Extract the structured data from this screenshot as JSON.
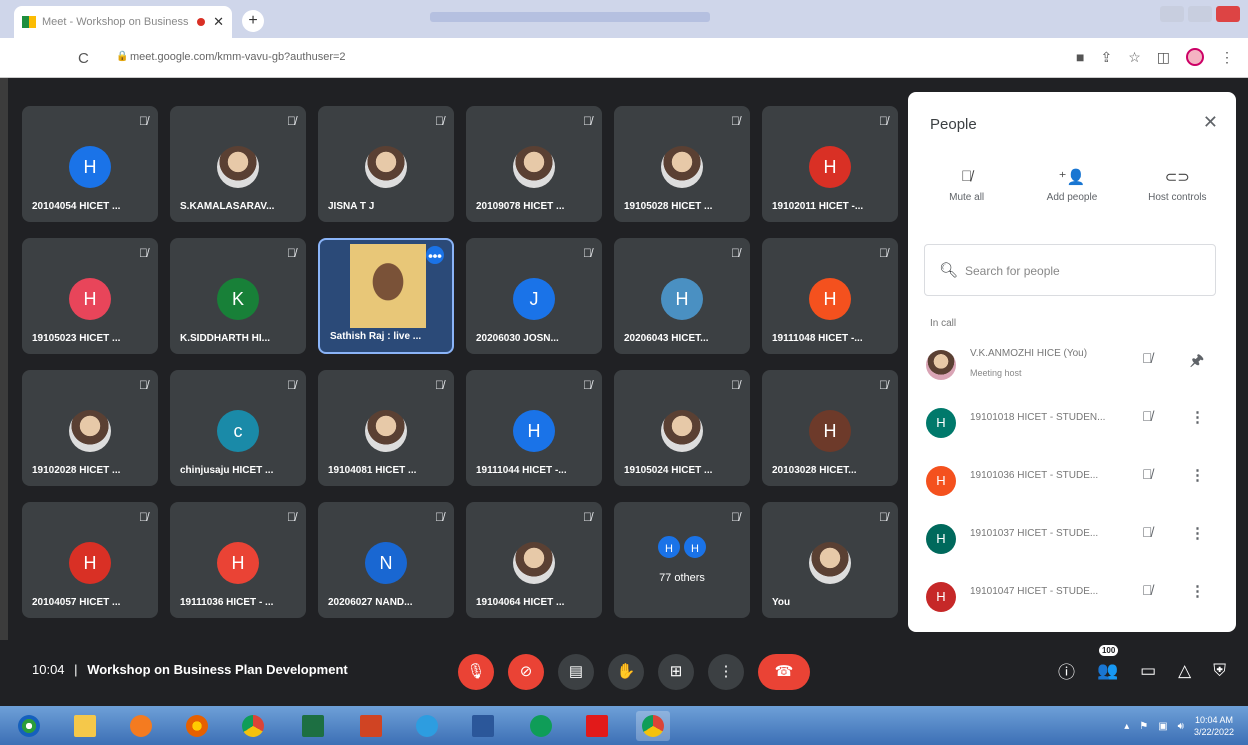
{
  "browser": {
    "tab_title": "Meet - Workshop on Business",
    "url": "meet.google.com/kmm-vavu-gb?authuser=2"
  },
  "tiles": [
    {
      "name": "20104054 HICET ...",
      "initial": "H",
      "color": "#1a73e8",
      "kind": "initial"
    },
    {
      "name": "S.KAMALASARAV...",
      "initial": "",
      "color": "#ccc",
      "kind": "photo"
    },
    {
      "name": "JISNA T J",
      "initial": "",
      "color": "#ccc",
      "kind": "photo"
    },
    {
      "name": "20109078 HICET ...",
      "initial": "",
      "color": "#888",
      "kind": "photo"
    },
    {
      "name": "19105028 HICET ...",
      "initial": "",
      "color": "#ccc",
      "kind": "photo"
    },
    {
      "name": "19102011 HICET -...",
      "initial": "H",
      "color": "#d93025",
      "kind": "initial"
    },
    {
      "name": "19105023 HICET ...",
      "initial": "H",
      "color": "#e8455a",
      "kind": "initial"
    },
    {
      "name": "K.SIDDHARTH HI...",
      "initial": "K",
      "color": "#188038",
      "kind": "initial"
    },
    {
      "name": "Sathish Raj : live ...",
      "initial": "",
      "color": "",
      "kind": "video"
    },
    {
      "name": "20206030 JOSN...",
      "initial": "J",
      "color": "#1a73e8",
      "kind": "initial"
    },
    {
      "name": "20206043 HICET...",
      "initial": "H",
      "color": "#4a90c2",
      "kind": "initial"
    },
    {
      "name": "19111048 HICET -...",
      "initial": "H",
      "color": "#f4511e",
      "kind": "initial"
    },
    {
      "name": "19102028 HICET ...",
      "initial": "",
      "color": "#ccc",
      "kind": "photo"
    },
    {
      "name": "chinjusaju HICET ...",
      "initial": "c",
      "color": "#1a8aa8",
      "kind": "initial"
    },
    {
      "name": "19104081 HICET ...",
      "initial": "",
      "color": "#666",
      "kind": "photo"
    },
    {
      "name": "19111044 HICET -...",
      "initial": "H",
      "color": "#1a73e8",
      "kind": "initial"
    },
    {
      "name": "19105024 HICET ...",
      "initial": "",
      "color": "#bbb",
      "kind": "photo"
    },
    {
      "name": "20103028 HICET...",
      "initial": "H",
      "color": "#6d3a2a",
      "kind": "initial"
    },
    {
      "name": "20104057 HICET ...",
      "initial": "H",
      "color": "#d93025",
      "kind": "initial"
    },
    {
      "name": "19111036 HICET - ...",
      "initial": "H",
      "color": "#ea4335",
      "kind": "initial"
    },
    {
      "name": "20206027 NAND...",
      "initial": "N",
      "color": "#1967d2",
      "kind": "initial"
    },
    {
      "name": "19104064 HICET ...",
      "initial": "",
      "color": "#ccc",
      "kind": "photo"
    },
    {
      "name": "77 others",
      "initial": "H",
      "color": "#1a73e8",
      "kind": "others"
    },
    {
      "name": "You",
      "initial": "",
      "color": "#ccc",
      "kind": "photo"
    }
  ],
  "people_panel": {
    "title": "People",
    "mute_all": "Mute all",
    "add_people": "Add people",
    "host_controls": "Host controls",
    "search_placeholder": "Search for people",
    "in_call": "In call",
    "participants": [
      {
        "name": "V.K.ANMOZHI HICE",
        "tag": "(You)",
        "sub": "Meeting host",
        "initial": "",
        "color": "#c77"
      },
      {
        "name": "19101018 HICET - STUDEN...",
        "tag": "",
        "sub": "",
        "initial": "H",
        "color": "#00796b"
      },
      {
        "name": "19101036 HICET - STUDE...",
        "tag": "",
        "sub": "",
        "initial": "H",
        "color": "#f4511e"
      },
      {
        "name": "19101037 HICET - STUDE...",
        "tag": "",
        "sub": "",
        "initial": "H",
        "color": "#00695c"
      },
      {
        "name": "19101047 HICET - STUDE...",
        "tag": "",
        "sub": "",
        "initial": "H",
        "color": "#c62828"
      }
    ]
  },
  "meeting": {
    "time": "10:04",
    "separator": "|",
    "title": "Workshop on Business Plan Development",
    "people_count": "100"
  },
  "taskbar": {
    "clock_time": "10:04 AM",
    "clock_date": "3/22/2022"
  }
}
